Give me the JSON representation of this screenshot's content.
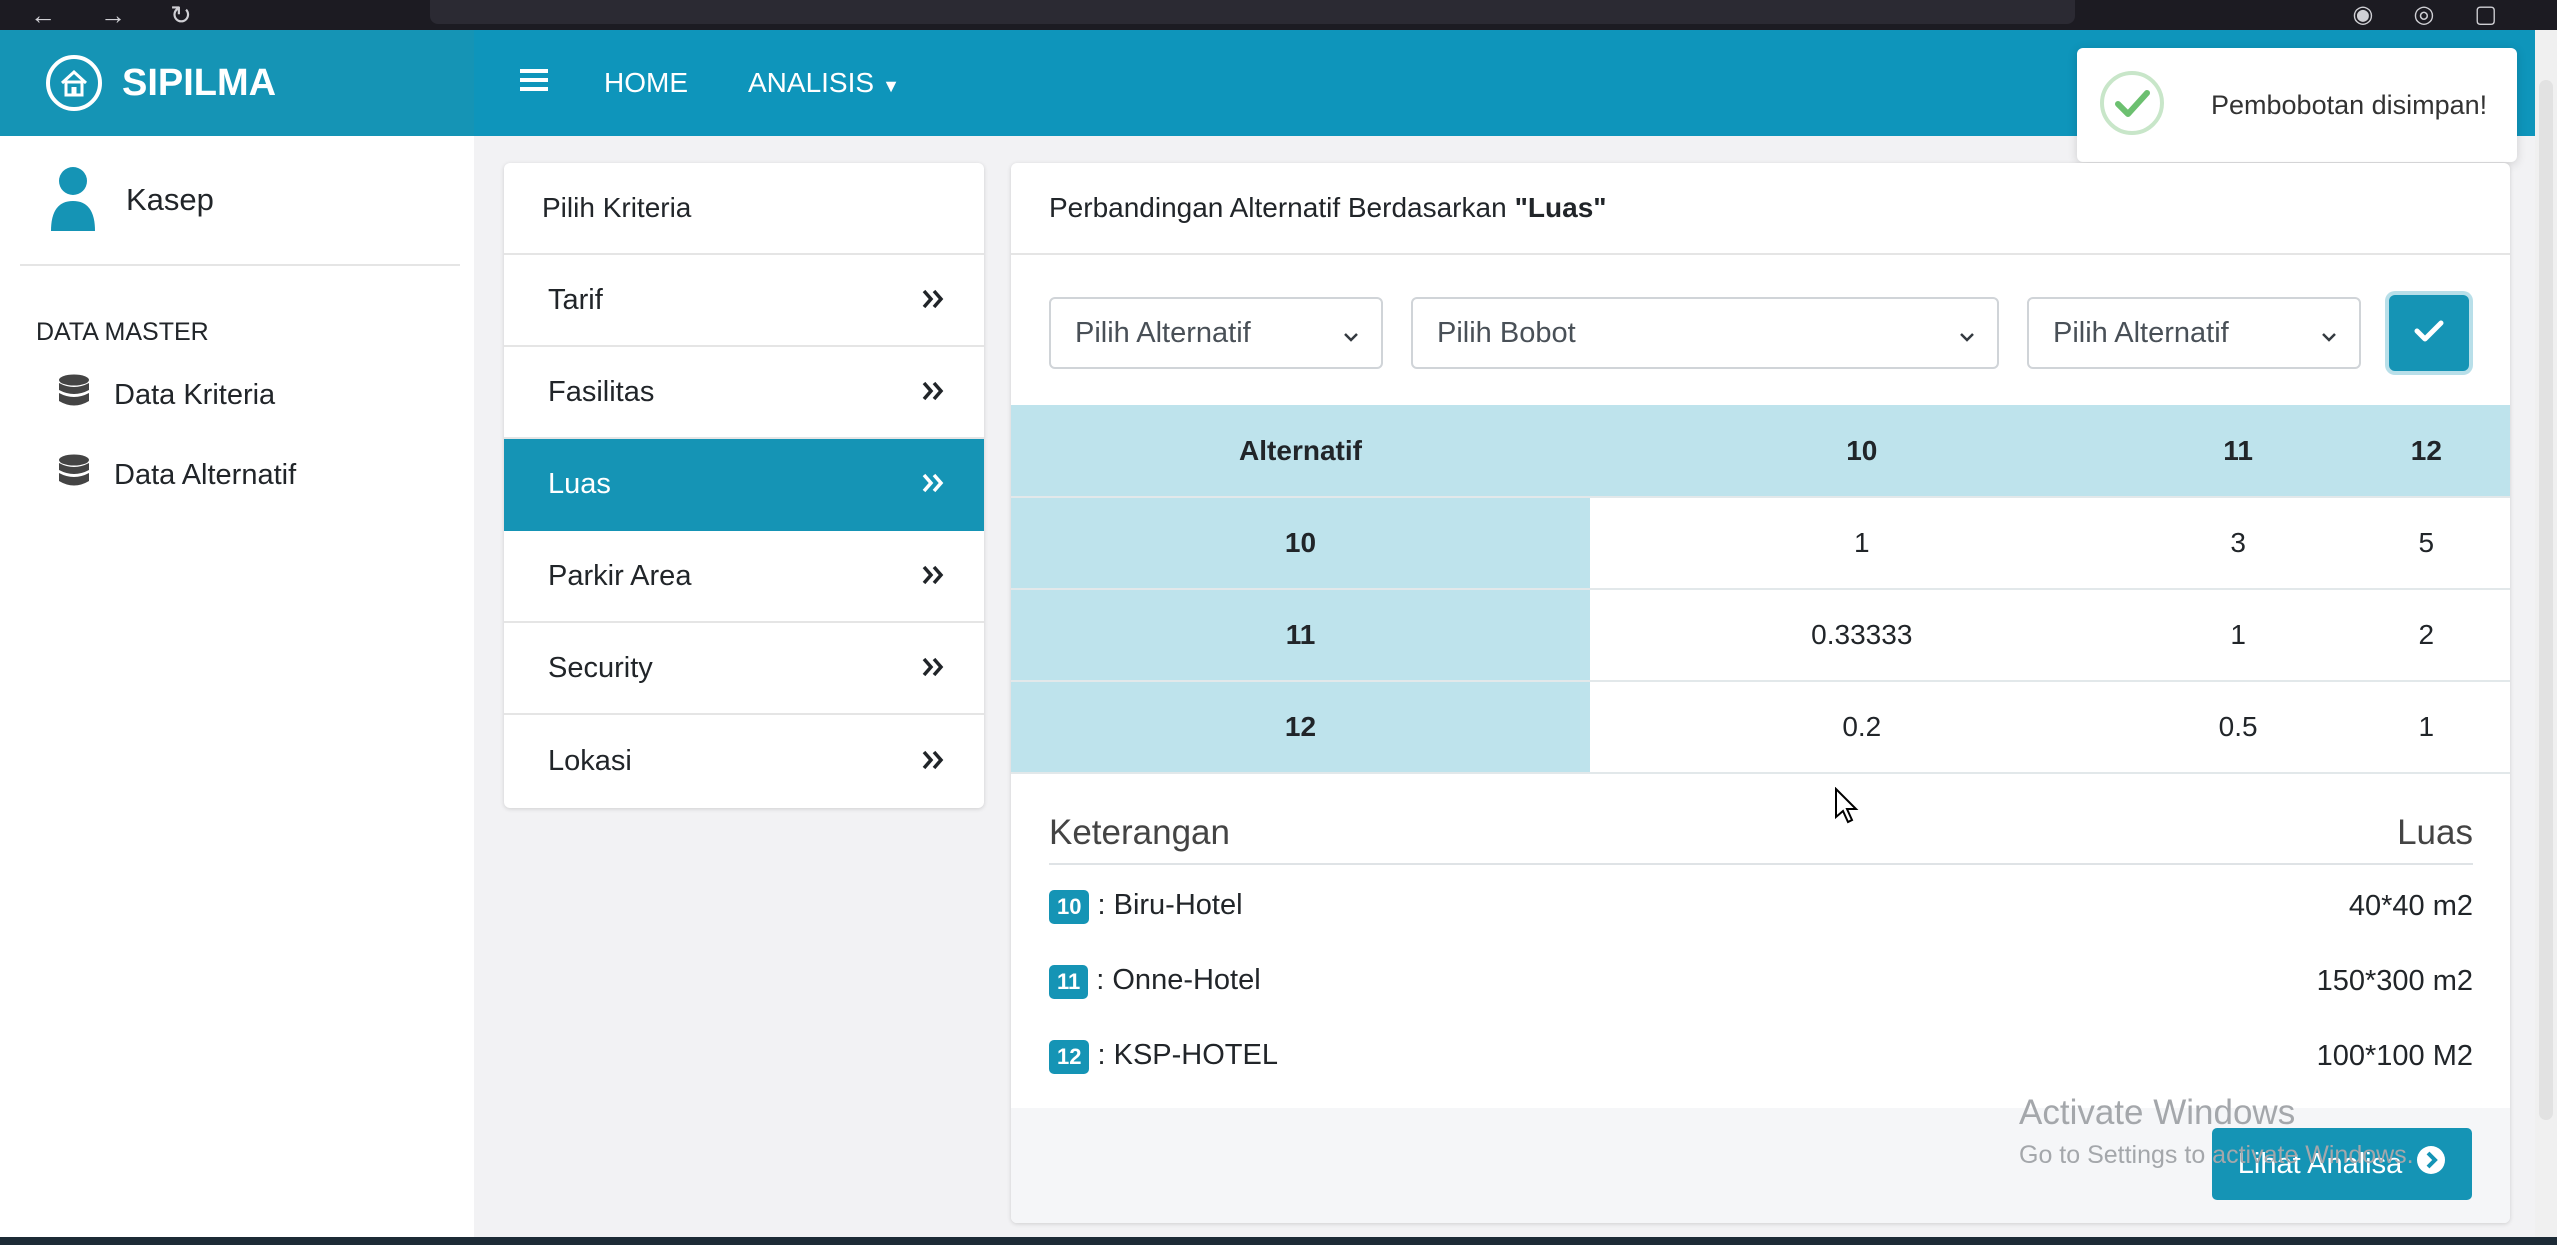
{
  "brand": {
    "name": "SIPILMA"
  },
  "sidebar": {
    "user_name": "Kasep",
    "section_header": "DATA MASTER",
    "items": [
      {
        "label": "Data Kriteria"
      },
      {
        "label": "Data Alternatif"
      }
    ]
  },
  "topnav": {
    "home": "HOME",
    "analisis": "ANALISIS"
  },
  "toast": {
    "message": "Pembobotan disimpan!"
  },
  "kriteria": {
    "header": "Pilih Kriteria",
    "items": [
      {
        "label": "Tarif",
        "active": false
      },
      {
        "label": "Fasilitas",
        "active": false
      },
      {
        "label": "Luas",
        "active": true
      },
      {
        "label": "Parkir Area",
        "active": false
      },
      {
        "label": "Security",
        "active": false
      },
      {
        "label": "Lokasi",
        "active": false
      }
    ],
    "chevron": "»"
  },
  "comparison": {
    "title_prefix": "Perbandingan Alternatif Berdasarkan",
    "title_criterion": "\"Luas\"",
    "select_alt_1": "Pilih Alternatif",
    "select_bobot": "Pilih Bobot",
    "select_alt_2": "Pilih Alternatif",
    "matrix": {
      "corner": "Alternatif",
      "columns": [
        "10",
        "11",
        "12"
      ],
      "rows": [
        {
          "label": "10",
          "values": [
            "1",
            "3",
            "5"
          ]
        },
        {
          "label": "11",
          "values": [
            "0.33333",
            "1",
            "2"
          ]
        },
        {
          "label": "12",
          "values": [
            "0.2",
            "0.5",
            "1"
          ]
        }
      ]
    },
    "keterangan": {
      "title": "Keterangan",
      "criterion": "Luas",
      "items": [
        {
          "code": "10",
          "name": ": Biru-Hotel",
          "value": "40*40 m2"
        },
        {
          "code": "11",
          "name": ": Onne-Hotel",
          "value": "150*300 m2"
        },
        {
          "code": "12",
          "name": ": KSP-HOTEL",
          "value": "100*100 M2"
        }
      ]
    },
    "button": "Lihat Analisa"
  },
  "watermark": {
    "line1": "Activate Windows",
    "line2": "Go to Settings to activate Windows."
  },
  "colors": {
    "primary": "#1594b5",
    "topbar": "#0e95bb",
    "header_cell": "#bee3ec",
    "success": "#6cc070"
  }
}
